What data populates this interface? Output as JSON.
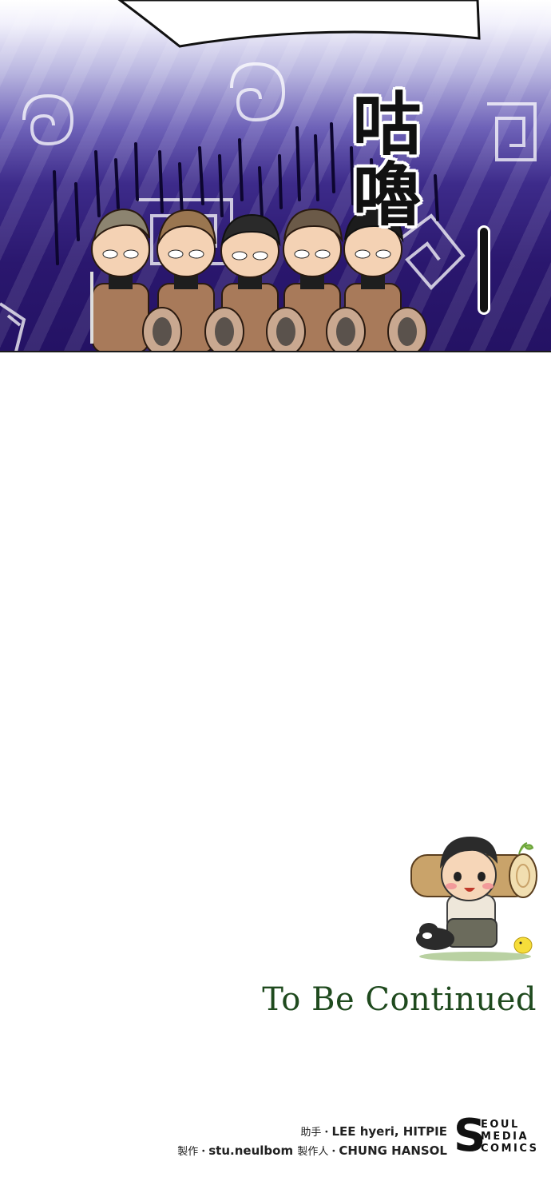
{
  "panel": {
    "sfx_text": "咕嚕",
    "sfx_trail": "—"
  },
  "ending": {
    "to_be_continued": "To Be Continued"
  },
  "credits": {
    "assistant_label": "助手・",
    "assistant_names": "LEE hyeri, HITPIE",
    "production_label": "製作・",
    "production_name": "stu.neulbom",
    "producer_label": "製作人・",
    "producer_name": "CHUNG HANSOL"
  },
  "publisher_logo": {
    "letter": "S",
    "line1": "EOUL",
    "line2": "MEDIA",
    "line3": "COMICS"
  },
  "colors": {
    "panel_dark": "#241264",
    "tbc_green": "#1f4a1e"
  }
}
